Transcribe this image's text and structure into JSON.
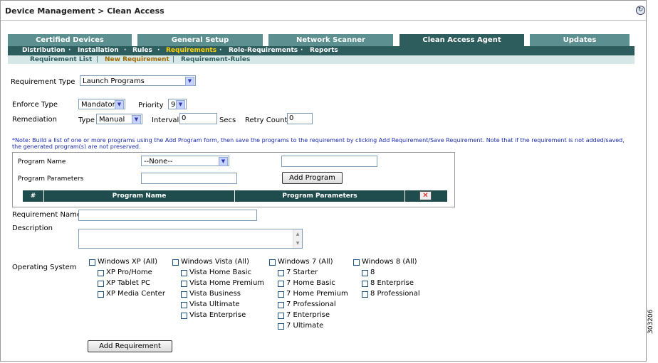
{
  "header": {
    "breadcrumb": "Device Management > Clean Access"
  },
  "tabs": [
    "Certified Devices",
    "General Setup",
    "Network Scanner",
    "Clean Access Agent",
    "Updates"
  ],
  "subnav": [
    "Distribution",
    "Installation",
    "Rules",
    "Requirements",
    "Role-Requirements",
    "Reports"
  ],
  "subnav2": [
    "Requirement List",
    "New Requirement",
    "Requirement-Rules"
  ],
  "form": {
    "req_type_label": "Requirement Type",
    "req_type_value": "Launch Programs",
    "enforce_label": "Enforce Type",
    "enforce_value": "Mandatory",
    "priority_label": "Priority",
    "priority_value": "9",
    "remediation_label": "Remediation",
    "type_label": "Type",
    "type_value": "Manual",
    "interval_label": "Interval",
    "interval_value": "0",
    "secs_label": "Secs",
    "retry_label": "Retry Count",
    "retry_value": "0",
    "note": "*Note: Build a list of one or more programs using the Add Program form, then save the programs to the requirement by clicking Add Requirement/Save Requirement. Note that if the requirement is not added/saved, the generated program(s) are not preserved.",
    "program_name_label": "Program Name",
    "program_name_select": "--None--",
    "program_params_label": "Program Parameters",
    "add_program_button": "Add Program",
    "table_headers": [
      "#",
      "Program Name",
      "Program Parameters"
    ],
    "req_name_label": "Requirement Name",
    "description_label": "Description",
    "os_label": "Operating System",
    "add_requirement_button": "Add Requirement"
  },
  "os_columns": [
    {
      "parent": "Windows XP (All)",
      "children": [
        "XP Pro/Home",
        "XP Tablet PC",
        "XP Media Center"
      ]
    },
    {
      "parent": "Windows Vista (All)",
      "children": [
        "Vista Home Basic",
        "Vista Home Premium",
        "Vista Business",
        "Vista Ultimate",
        "Vista Enterprise"
      ]
    },
    {
      "parent": "Windows 7 (All)",
      "children": [
        "7 Starter",
        "7 Home Basic",
        "7 Home Premium",
        "7 Professional",
        "7 Enterprise",
        "7 Ultimate"
      ]
    },
    {
      "parent": "Windows 8 (All)",
      "children": [
        "8",
        "8 Enterprise",
        "8 Professional"
      ]
    }
  ],
  "figure_id": "303206",
  "colors": {
    "tab": "#5c8f8f",
    "tab_active": "#2d5d5d",
    "nav_highlight": "#ffd200",
    "note_text": "#1a2bb0"
  }
}
